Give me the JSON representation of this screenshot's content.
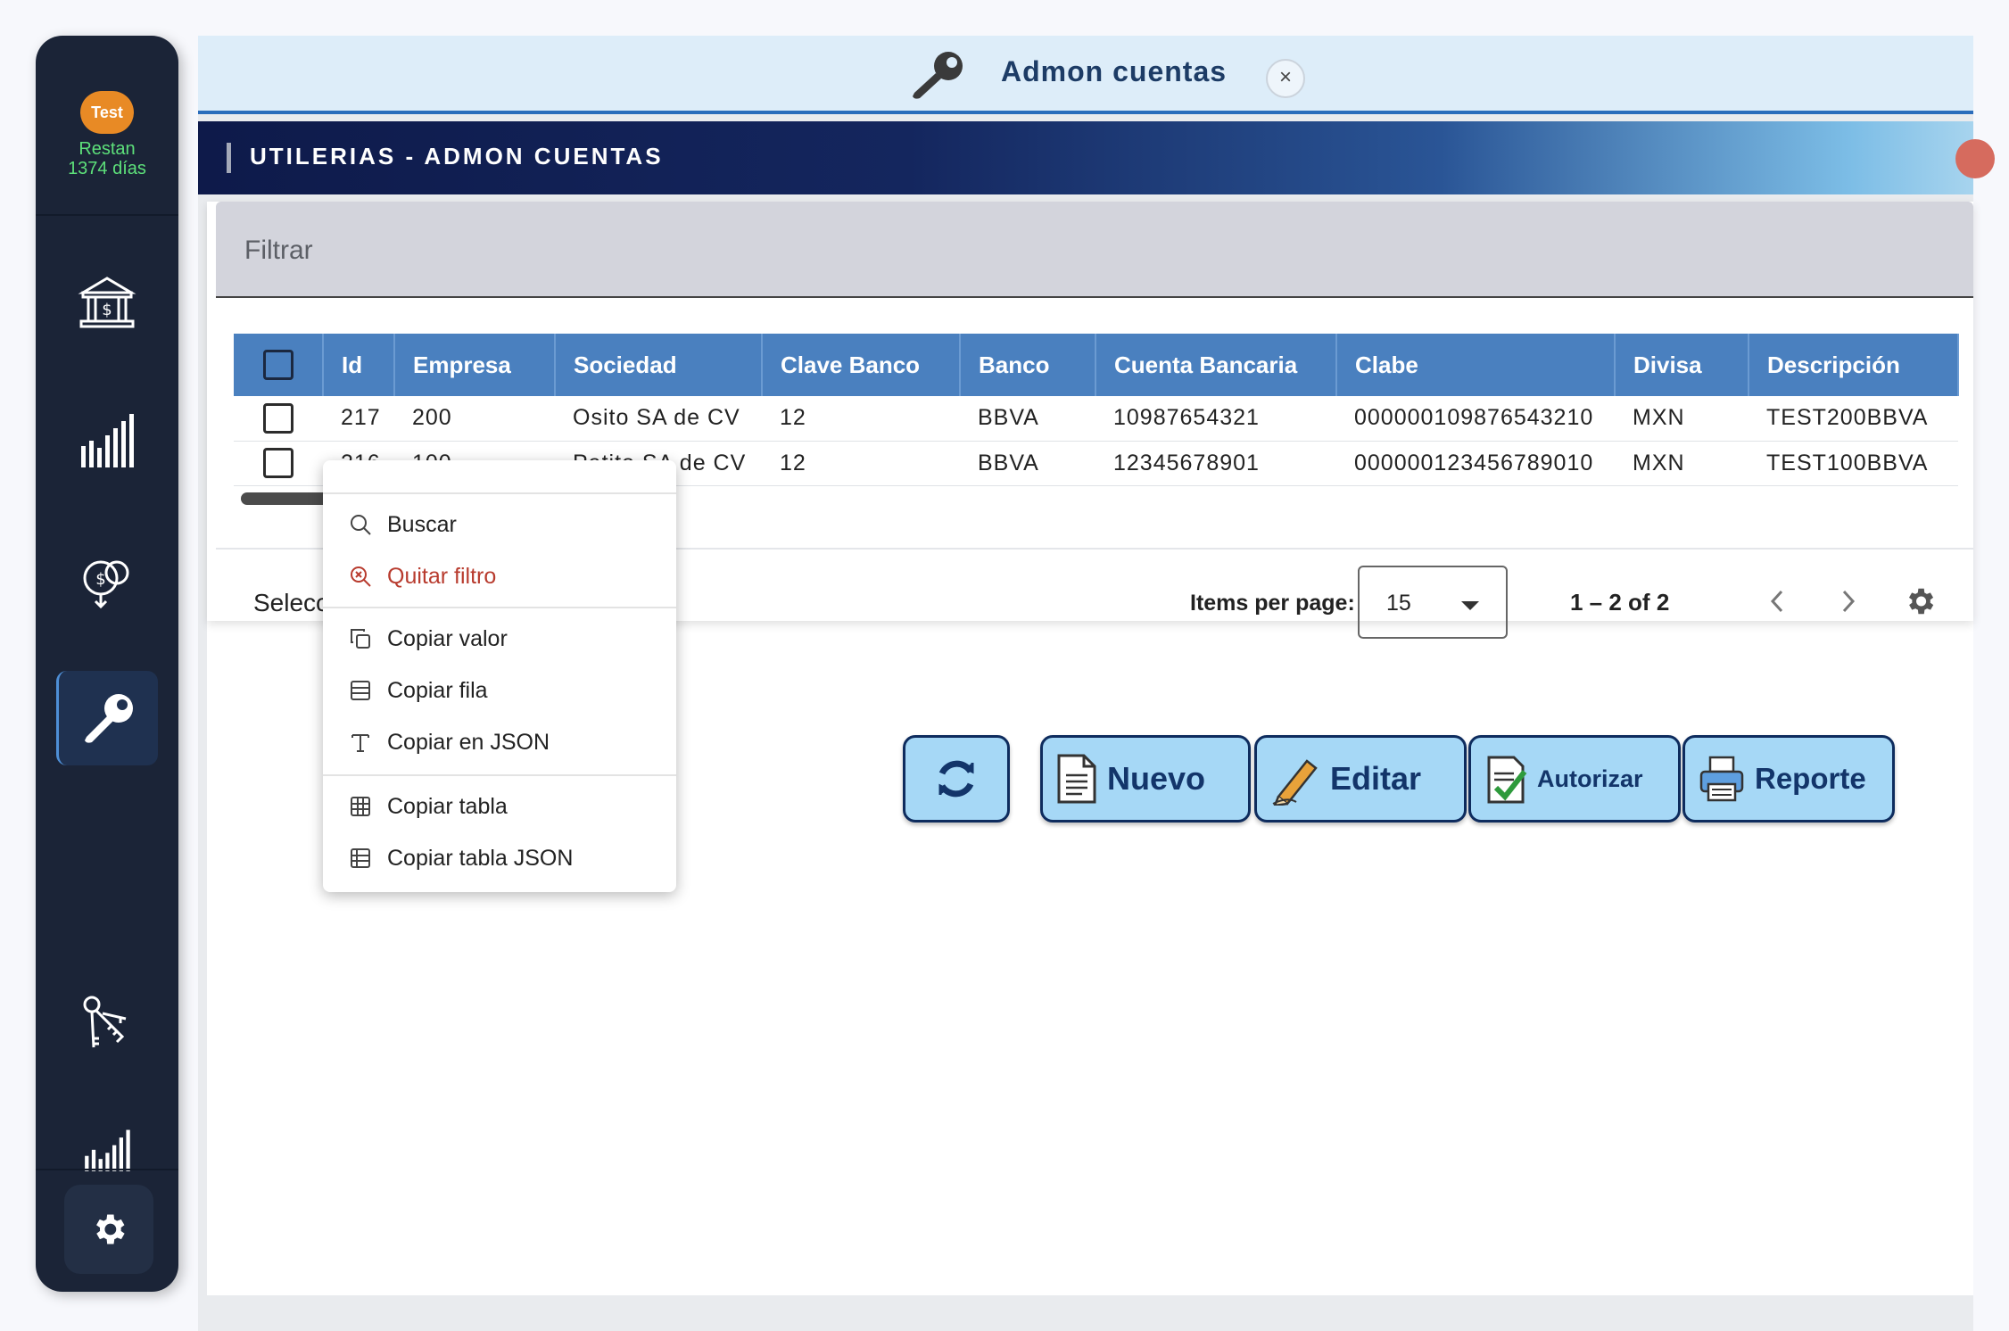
{
  "sidebar": {
    "badge": "Test",
    "remaining_line1": "Restan",
    "remaining_line2": "1374 días",
    "items": [
      {
        "icon": "bank-icon"
      },
      {
        "icon": "bar-chart-icon"
      },
      {
        "icon": "money-network-icon"
      },
      {
        "icon": "wrench-icon",
        "active": true
      },
      {
        "icon": "keys-icon"
      },
      {
        "icon": "small-bar-chart-icon"
      }
    ],
    "settings_icon": "gear-icon"
  },
  "tab": {
    "title": "Admon cuentas",
    "close": "×"
  },
  "banner": {
    "title": "UTILERIAS - ADMON CUENTAS"
  },
  "filter": {
    "label": "Filtrar"
  },
  "table": {
    "columns": [
      "Id",
      "Empresa",
      "Sociedad",
      "Clave Banco",
      "Banco",
      "Cuenta Bancaria",
      "Clabe",
      "Divisa",
      "Descripción"
    ],
    "rows": [
      [
        "217",
        "200",
        "Osito SA de CV",
        "12",
        "BBVA",
        "10987654321",
        "000000109876543210",
        "MXN",
        "TEST200BBVA"
      ],
      [
        "216",
        "100",
        "Patito SA de CV",
        "12",
        "BBVA",
        "12345678901",
        "000000123456789010",
        "MXN",
        "TEST100BBVA"
      ]
    ]
  },
  "footer": {
    "selection_text": "Selecc",
    "items_per_page_label": "Items per page:",
    "items_per_page_value": "15",
    "range": "1 – 2 of 2"
  },
  "buttons": {
    "nuevo": "Nuevo",
    "editar": "Editar",
    "autorizar": "Autorizar",
    "reporte": "Reporte"
  },
  "context_menu": {
    "items": [
      {
        "label": "Buscar",
        "icon": "search-icon"
      },
      {
        "label": "Quitar filtro",
        "icon": "clear-filter-icon"
      },
      {
        "label": "Copiar valor",
        "icon": "copy-icon"
      },
      {
        "label": "Copiar fila",
        "icon": "row-icon"
      },
      {
        "label": "Copiar en JSON",
        "icon": "text-icon"
      },
      {
        "label": "Copiar tabla",
        "icon": "grid-icon"
      },
      {
        "label": "Copiar tabla JSON",
        "icon": "table-icon"
      }
    ]
  },
  "colors": {
    "sidebar_bg": "#1b2437",
    "header_blue": "#4a80bf",
    "button_bg": "#a6d8f6",
    "accent_orange": "#e88a25",
    "remaining_green": "#5de07a",
    "danger_red": "#b83b2e"
  }
}
